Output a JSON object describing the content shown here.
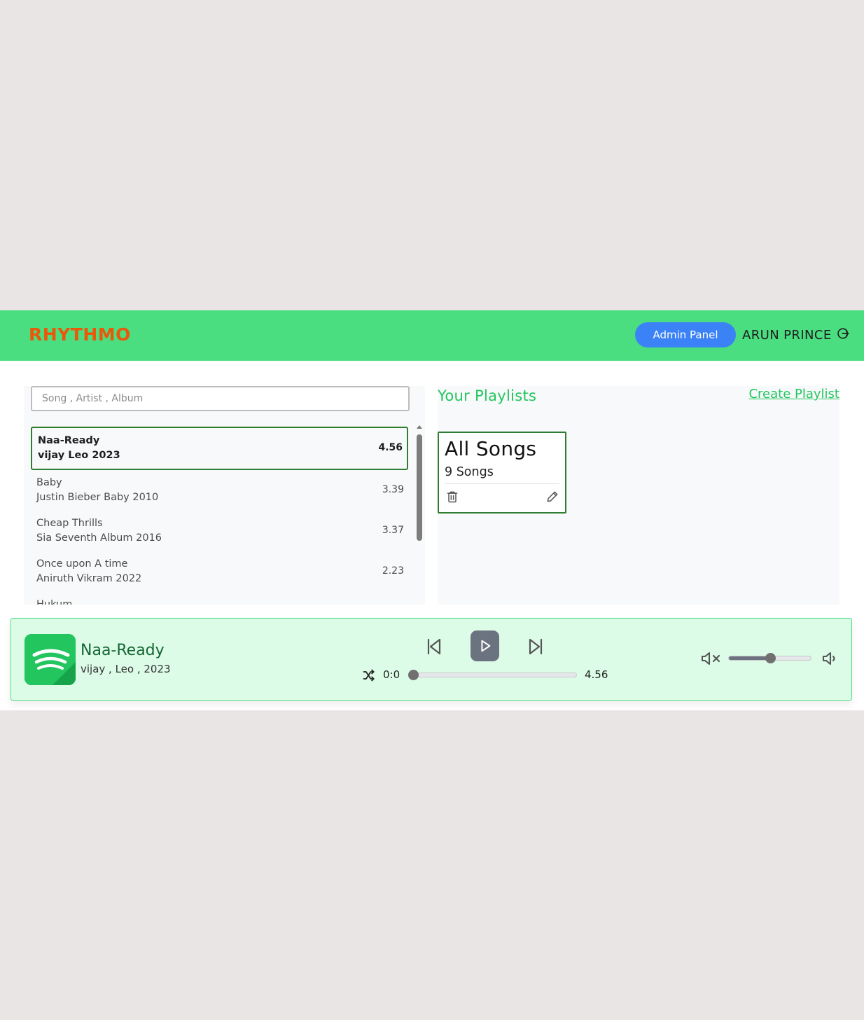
{
  "app": {
    "brand": "RHYTHMO"
  },
  "navbar": {
    "admin_button": "Admin Panel",
    "user_name": "ARUN PRINCE",
    "logout_icon": "logout-icon"
  },
  "search": {
    "placeholder": "Song , Artist , Album",
    "value": ""
  },
  "songs": [
    {
      "title": "Naa-Ready",
      "meta": "vijay Leo 2023",
      "duration": "4.56",
      "active": true
    },
    {
      "title": "Baby",
      "meta": "Justin Bieber Baby 2010",
      "duration": "3.39",
      "active": false
    },
    {
      "title": "Cheap Thrills",
      "meta": "Sia Seventh Album 2016",
      "duration": "3.37",
      "active": false
    },
    {
      "title": "Once upon A time",
      "meta": "Aniruth Vikram 2022",
      "duration": "2.23",
      "active": false
    },
    {
      "title": "Hukum",
      "meta": "",
      "duration": "",
      "active": false
    }
  ],
  "playlists": {
    "title": "Your Playlists",
    "create_label": "Create Playlist",
    "items": [
      {
        "name": "All Songs",
        "count": "9 Songs"
      }
    ]
  },
  "player": {
    "title": "Naa-Ready",
    "subtitle": "vijay , Leo , 2023",
    "current_time": "0:0",
    "total_time": "4.56",
    "progress": 0,
    "volume": 0.5
  },
  "colors": {
    "navbar": "#4ade80",
    "brand": "#ea580c",
    "accent": "#22c55e",
    "admin_button": "#3b82f6",
    "player_bg": "#dcfce7"
  }
}
